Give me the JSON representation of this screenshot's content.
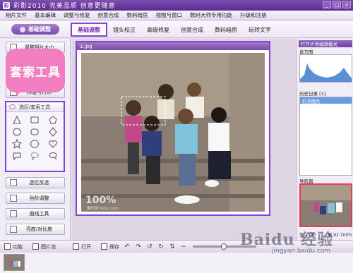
{
  "window": {
    "title": "彩影2010  完美品质  创意更随意",
    "app_icon_label": "彩"
  },
  "window_controls": [
    "_",
    "□",
    "×"
  ],
  "menu": [
    "相片文件",
    "基本编辑",
    "调整与修复",
    "创意合成",
    "数码暗房",
    "视图与窗口",
    "数码大师专用功能",
    "升级和注册"
  ],
  "toolbar": {
    "basic_button": "基础调整",
    "tabs": [
      "基础调整",
      "镜头校正",
      "高级修复",
      "创意合成",
      "数码暗房",
      "玩转文字"
    ],
    "active_tab_index": 0
  },
  "left_panel": {
    "resize_button": "调整相片大小",
    "print_button": "排版与打印",
    "callout_text": "套索工具",
    "lasso_header": "选区/套索工具",
    "lasso_shapes": [
      "triangle",
      "rectangle",
      "pentagon",
      "circle",
      "rounded-rect",
      "diamond",
      "star",
      "hexagon",
      "heart",
      "speech-bubble",
      "freehand-lasso",
      "magic-lasso"
    ],
    "buttons_below": [
      "选区反选",
      "色阶调整",
      "曲线工具",
      "亮度/对比度"
    ]
  },
  "canvas": {
    "image_tab": "1.jpg",
    "watermark_big": "100%",
    "watermark_small": "素田网  hipic.com"
  },
  "right_panel": {
    "header": "打开大师编辑模式",
    "histogram_label": "直方图",
    "history_label": "历史记录 [1]",
    "history_items": [
      "打开图片"
    ],
    "navigator_label": "导航器",
    "size_left": "宽 2000",
    "size_right": "高 92  100%"
  },
  "bottom_bar": {
    "function_tab": "功能",
    "filmstrip_tab": "图片池",
    "open_label": "打开",
    "save_label": "保存"
  },
  "watermark": {
    "brand": "Baidu 经验",
    "url": "jingyan.baidu.com"
  },
  "colors": {
    "accent": "#8b3fd0",
    "callout": "#f07ec0",
    "title_bar": "#5a2b8c"
  }
}
